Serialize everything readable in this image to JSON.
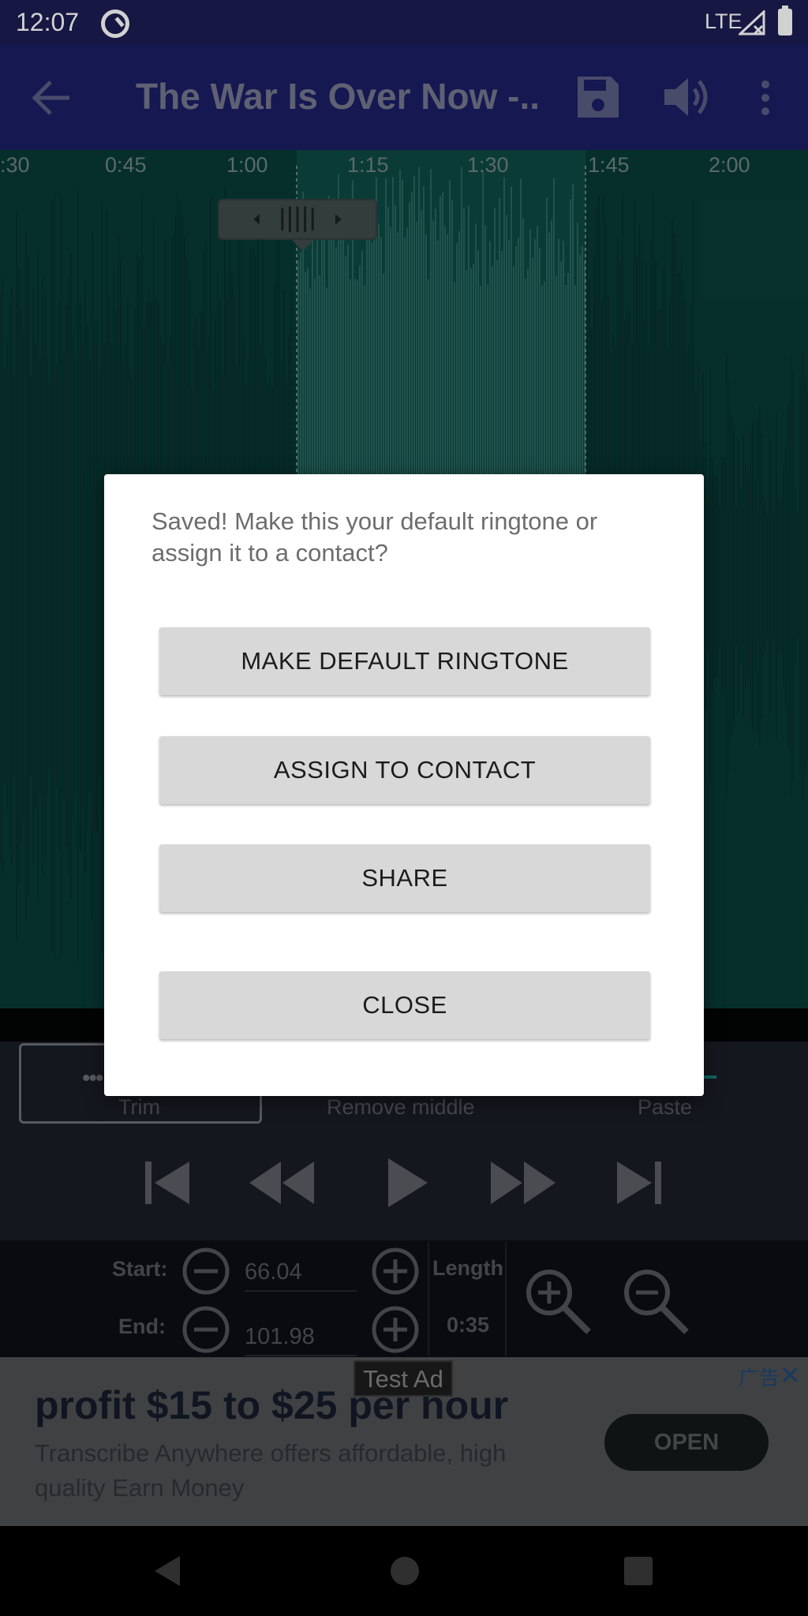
{
  "status_bar": {
    "time": "12:07",
    "network": "LTE"
  },
  "app_bar": {
    "title": "The War Is Over Now -...",
    "icons": [
      "back-arrow-icon",
      "save-icon",
      "volume-icon",
      "more-vert-icon"
    ]
  },
  "timeline": {
    "ticks": [
      ":30",
      "0:45",
      "1:00",
      "1:15",
      "1:30",
      "1:45",
      "2:00"
    ]
  },
  "edit_modes": {
    "trim": "Trim",
    "remove_middle": "Remove middle",
    "paste": "Paste",
    "selected": "Trim"
  },
  "transport": {
    "icons": [
      "skip-previous-icon",
      "rewind-icon",
      "play-icon",
      "fast-forward-icon",
      "skip-next-icon"
    ]
  },
  "selection": {
    "start_label": "Start:",
    "start_value": "66.04",
    "end_label": "End:",
    "end_value": "101.98",
    "length_label": "Length",
    "length_value": "0:35"
  },
  "ad": {
    "tag": "Test Ad",
    "choices": "广告",
    "close": "✕",
    "headline": "profit $15 to $25 per hour",
    "body": "Transcribe Anywhere offers affordable, high quality Earn Money",
    "cta": "OPEN"
  },
  "dialog": {
    "message": "Saved! Make this your default ringtone or assign it to a contact?",
    "make_default": "MAKE DEFAULT RINGTONE",
    "assign_contact": "ASSIGN TO CONTACT",
    "share": "SHARE",
    "close": "CLOSE"
  },
  "colors": {
    "accent": "#2b2f9c",
    "waveform": "#0d5a54",
    "selection": "#3f9d90",
    "teal_line": "#1fc3b5"
  }
}
